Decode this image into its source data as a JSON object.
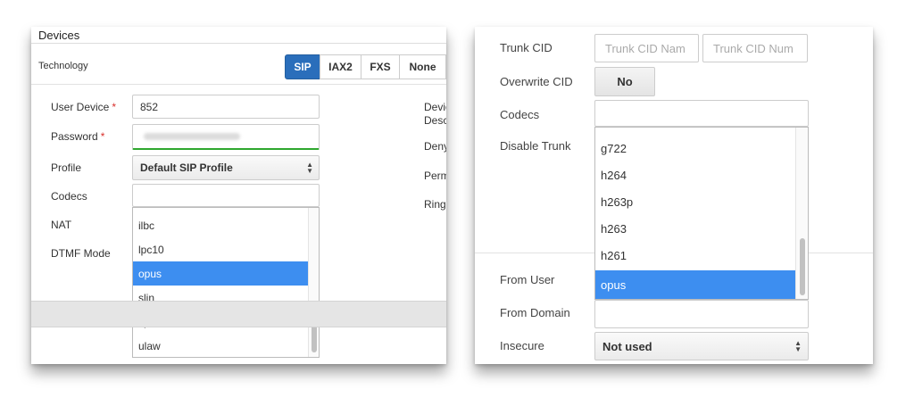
{
  "left": {
    "section_title": "Devices",
    "technology_label": "Technology",
    "tech_buttons": [
      "SIP",
      "IAX2",
      "FXS",
      "None"
    ],
    "tech_selected": "SIP",
    "user_device_label": "User Device",
    "user_device_value": "852",
    "password_label": "Password",
    "profile_label": "Profile",
    "profile_value": "Default SIP Profile",
    "codecs_label": "Codecs",
    "nat_label": "NAT",
    "dtmf_label": "DTMF Mode",
    "codec_options": [
      "ilbc",
      "lpc10",
      "opus",
      "slin",
      "speex",
      "ulaw"
    ],
    "codec_selected": "opus",
    "required_mark": "*",
    "cut_labels": [
      "Devic",
      "Descr",
      "Deny",
      "Perm",
      "Ring"
    ]
  },
  "right": {
    "trunk_cid_label": "Trunk CID",
    "trunk_cid_name_placeholder": "Trunk CID Nam",
    "trunk_cid_number_placeholder": "Trunk CID Num",
    "overwrite_cid_label": "Overwrite CID",
    "overwrite_cid_value": "No",
    "codecs_label": "Codecs",
    "disable_trunk_label": "Disable Trunk",
    "codec_options": [
      "g722",
      "h264",
      "h263p",
      "h263",
      "h261",
      "opus"
    ],
    "codec_selected": "opus",
    "from_user_label": "From User",
    "from_domain_label": "From Domain",
    "insecure_label": "Insecure",
    "insecure_value": "Not used"
  },
  "colors": {
    "accent": "#2a6ebb",
    "selected_option": "#3d8ef0",
    "valid_underline": "#2ea72e",
    "required": "#d9302c"
  }
}
